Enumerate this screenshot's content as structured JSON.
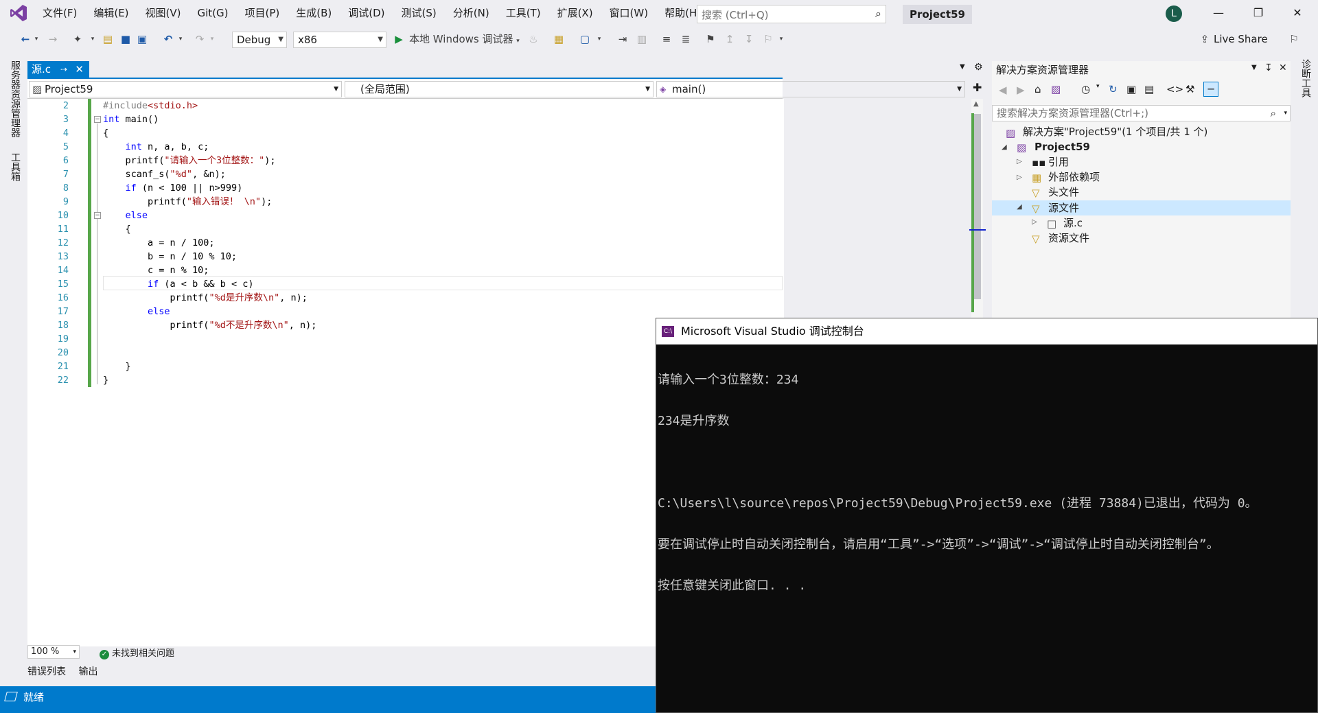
{
  "menubar": {
    "items": [
      "文件(F)",
      "编辑(E)",
      "视图(V)",
      "Git(G)",
      "项目(P)",
      "生成(B)",
      "调试(D)",
      "测试(S)",
      "分析(N)",
      "工具(T)",
      "扩展(X)",
      "窗口(W)",
      "帮助(H)"
    ],
    "search_placeholder": "搜索 (Ctrl+Q)",
    "project_name": "Project59",
    "avatar_letter": "L"
  },
  "toolbar": {
    "config": "Debug",
    "platform": "x86",
    "run_label": "本地 Windows 调试器",
    "live_share": "Live Share"
  },
  "left_tabs": [
    "服务器资源管理器",
    "工具箱"
  ],
  "right_tab": "诊断工具",
  "editor": {
    "tab_label": "源.c",
    "nav_project": "Project59",
    "nav_scope": "(全局范围)",
    "nav_member": "main()",
    "line_numbers": [
      "2",
      "3",
      "4",
      "5",
      "6",
      "7",
      "8",
      "9",
      "10",
      "11",
      "12",
      "13",
      "14",
      "15",
      "16",
      "17",
      "18",
      "19",
      "20",
      "21",
      "22"
    ],
    "zoom": "100 %",
    "issues": "未找到相关问题",
    "bottom_tabs": [
      "错误列表",
      "输出"
    ]
  },
  "status": {
    "text": "就绪"
  },
  "solution_explorer": {
    "title": "解决方案资源管理器",
    "search_placeholder": "搜索解决方案资源管理器(Ctrl+;)",
    "solution_label": "解决方案\"Project59\"(1 个项目/共 1 个)",
    "project_label": "Project59",
    "nodes": [
      "引用",
      "外部依赖项",
      "头文件",
      "源文件",
      "源.c",
      "资源文件"
    ]
  },
  "console": {
    "title": "Microsoft Visual Studio 调试控制台",
    "icon_text": "C:\\",
    "lines": [
      "请输入一个3位整数：234",
      "234是升序数",
      "",
      "C:\\Users\\l\\source\\repos\\Project59\\Debug\\Project59.exe (进程 73884)已退出，代码为 0。",
      "要在调试停止时自动关闭控制台，请启用“工具”->“选项”->“调试”->“调试停止时自动关闭控制台”。",
      "按任意键关闭此窗口. . ."
    ]
  }
}
